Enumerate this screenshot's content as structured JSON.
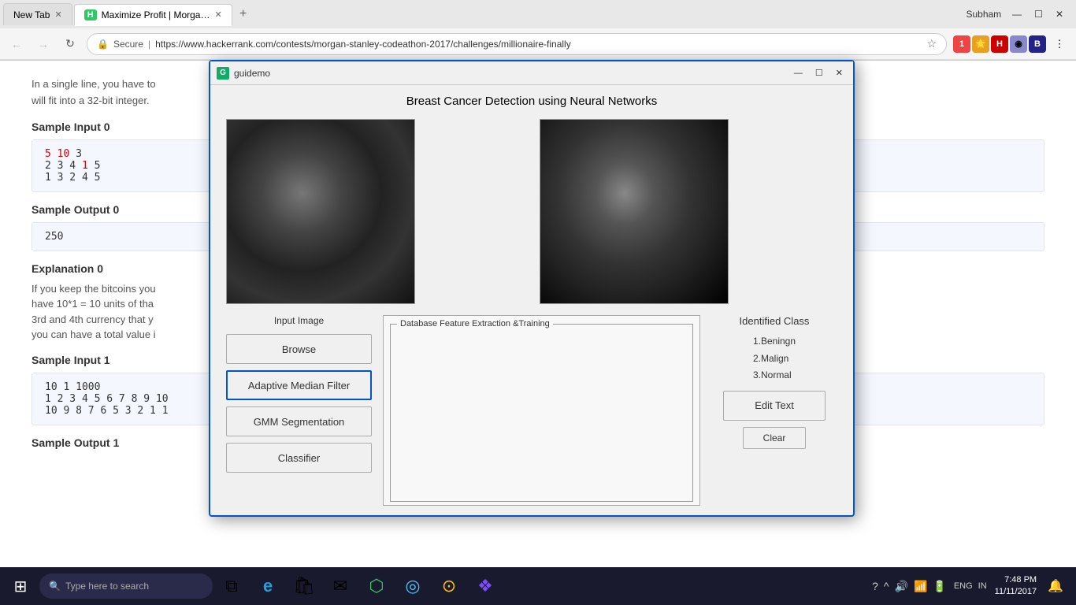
{
  "browser": {
    "tabs": [
      {
        "id": "tab1",
        "title": "New Tab",
        "active": false,
        "favicon": ""
      },
      {
        "id": "tab2",
        "title": "Maximize Profit | Morga…",
        "active": true,
        "favicon": "H"
      }
    ],
    "user_name": "Subham",
    "window_controls": {
      "minimize": "—",
      "maximize": "☐",
      "close": "✕"
    },
    "address": {
      "secure_label": "Secure",
      "url": "https://www.hackerrank.com/contests/morgan-stanley-codeathon-2017/challenges/millionaire-finally",
      "favicon": "HR"
    }
  },
  "page": {
    "sections": [
      {
        "type": "text",
        "text": "In a single line, you have to"
      },
      {
        "type": "text",
        "text": "will fit into a 32-bit integer."
      },
      {
        "type": "heading",
        "text": "Sample Input 0"
      },
      {
        "type": "code",
        "lines": [
          "5 10 3",
          "2 3 4 1 5",
          "1 3 2 4 5"
        ]
      },
      {
        "type": "heading",
        "text": "Sample Output 0"
      },
      {
        "type": "code",
        "lines": [
          "250"
        ]
      },
      {
        "type": "heading",
        "text": "Explanation 0"
      },
      {
        "type": "explanation",
        "text": "If you keep the bitcoins you have 10*1 = 10 units of tha 3rd and 4th currency that y you can have a total value i"
      },
      {
        "type": "heading",
        "text": "Sample Input 1"
      },
      {
        "type": "code",
        "lines": [
          "10 1 1000",
          "1 2 3 4 5 6 7 8 9 10",
          "10 9 8 7 6 5 3 2 1 1"
        ]
      }
    ]
  },
  "dialog": {
    "title": "guidemo",
    "icon_text": "G",
    "main_title": "Breast Cancer Detection using Neural Networks",
    "left_panel": {
      "label": "Input Image",
      "buttons": [
        {
          "id": "browse",
          "label": "Browse",
          "highlighted": false
        },
        {
          "id": "adaptive_median_filter",
          "label": "Adaptive Median Filter",
          "highlighted": true
        },
        {
          "id": "gmm_segmentation",
          "label": "GMM Segmentation",
          "highlighted": false
        },
        {
          "id": "classifier",
          "label": "Classifier",
          "highlighted": false
        }
      ]
    },
    "middle_panel": {
      "title": "Database Feature Extraction &Training"
    },
    "right_panel": {
      "label": "Identified Class",
      "classes": [
        "1.Beningn",
        "2.Malign",
        "3.Normal"
      ],
      "edit_text_label": "Edit Text",
      "clear_label": "Clear"
    },
    "window_controls": {
      "minimize": "—",
      "restore": "☐",
      "close": "✕"
    }
  },
  "taskbar": {
    "search_placeholder": "Type here to search",
    "apps": [
      {
        "id": "task-view",
        "icon": "⧉",
        "label": "Task View"
      },
      {
        "id": "edge",
        "icon": "e",
        "label": "Microsoft Edge"
      },
      {
        "id": "store",
        "icon": "🛍",
        "label": "Store"
      },
      {
        "id": "mail",
        "icon": "✉",
        "label": "Mail"
      },
      {
        "id": "hackerrank",
        "icon": "⬡",
        "label": "HackerRank"
      },
      {
        "id": "browser2",
        "icon": "◎",
        "label": "Browser"
      },
      {
        "id": "chrome",
        "icon": "⊙",
        "label": "Chrome"
      },
      {
        "id": "vs",
        "icon": "❖",
        "label": "Visual Studio"
      }
    ],
    "tray": {
      "icons": [
        "?",
        "^",
        "🔊",
        "📶",
        "🔋"
      ],
      "lang": "ENG",
      "region": "IN",
      "time": "7:48 PM",
      "date": "11/11/2017"
    }
  }
}
